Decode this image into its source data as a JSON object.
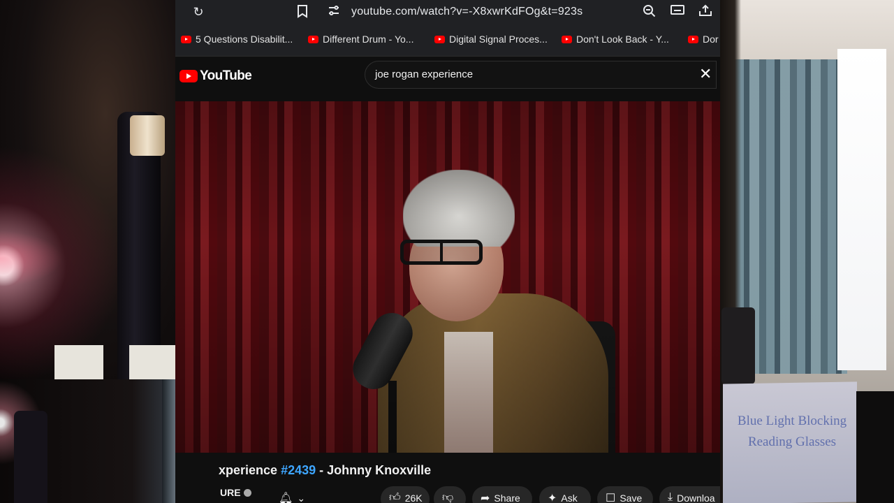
{
  "browser": {
    "url": "youtube.com/watch?v=-X8xwrKdFOg&t=923s",
    "icons": [
      "refresh-icon",
      "bookmark-icon",
      "site-settings-icon",
      "zoom-icon",
      "cast-icon",
      "share-icon"
    ]
  },
  "bookmarks": [
    {
      "label": "5 Questions Disabilit..."
    },
    {
      "label": "Different Drum - Yo..."
    },
    {
      "label": "Digital Signal Proces..."
    },
    {
      "label": "Don't Look Back - Y..."
    },
    {
      "label": "Dor"
    }
  ],
  "youtube": {
    "logo_text": "YouTube",
    "search_query": "joe rogan experience"
  },
  "video": {
    "title_prefix": "xperience ",
    "episode_tag": "#2439",
    "title_suffix": " - Johnny Knoxville",
    "channel": "URE"
  },
  "actions": {
    "likes": "26K",
    "share": "Share",
    "ask": "Ask",
    "save": "Save",
    "download": "Downloa"
  },
  "webcam": {
    "box_text_line1": "Blue Light Blocking",
    "box_text_line2": "Reading Glasses"
  },
  "colors": {
    "accent": "#ff0000",
    "link": "#3ea6ff"
  }
}
